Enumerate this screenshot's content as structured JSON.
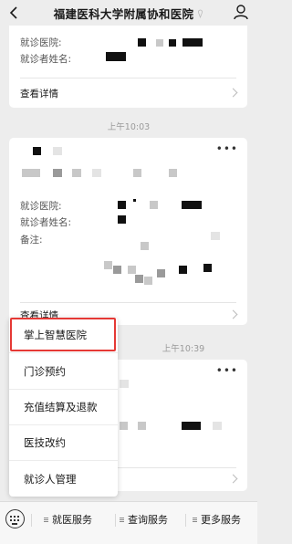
{
  "header": {
    "title": "福建医科大学附属协和医院"
  },
  "card1": {
    "hospital_label": "就诊医院:",
    "patient_label": "就诊者姓名:",
    "detail_link": "查看详情"
  },
  "timestamps": {
    "t1": "上午10:03",
    "t2": "上午10:39"
  },
  "card2": {
    "more": "•••",
    "hospital_label": "就诊医院:",
    "patient_label": "就诊者姓名:",
    "note_label": "备注:",
    "detail_link": "查看详情"
  },
  "card3": {
    "more": "•••"
  },
  "menu": {
    "items": [
      {
        "label": "掌上智慧医院"
      },
      {
        "label": "门诊预约"
      },
      {
        "label": "充值结算及退款"
      },
      {
        "label": "医技改约"
      },
      {
        "label": "就诊人管理"
      }
    ]
  },
  "bottombar": {
    "tabs": [
      {
        "label": "就医服务"
      },
      {
        "label": "查询服务"
      },
      {
        "label": "更多服务"
      }
    ]
  },
  "colors": {
    "highlight": "#e53935",
    "background": "#ededed"
  }
}
